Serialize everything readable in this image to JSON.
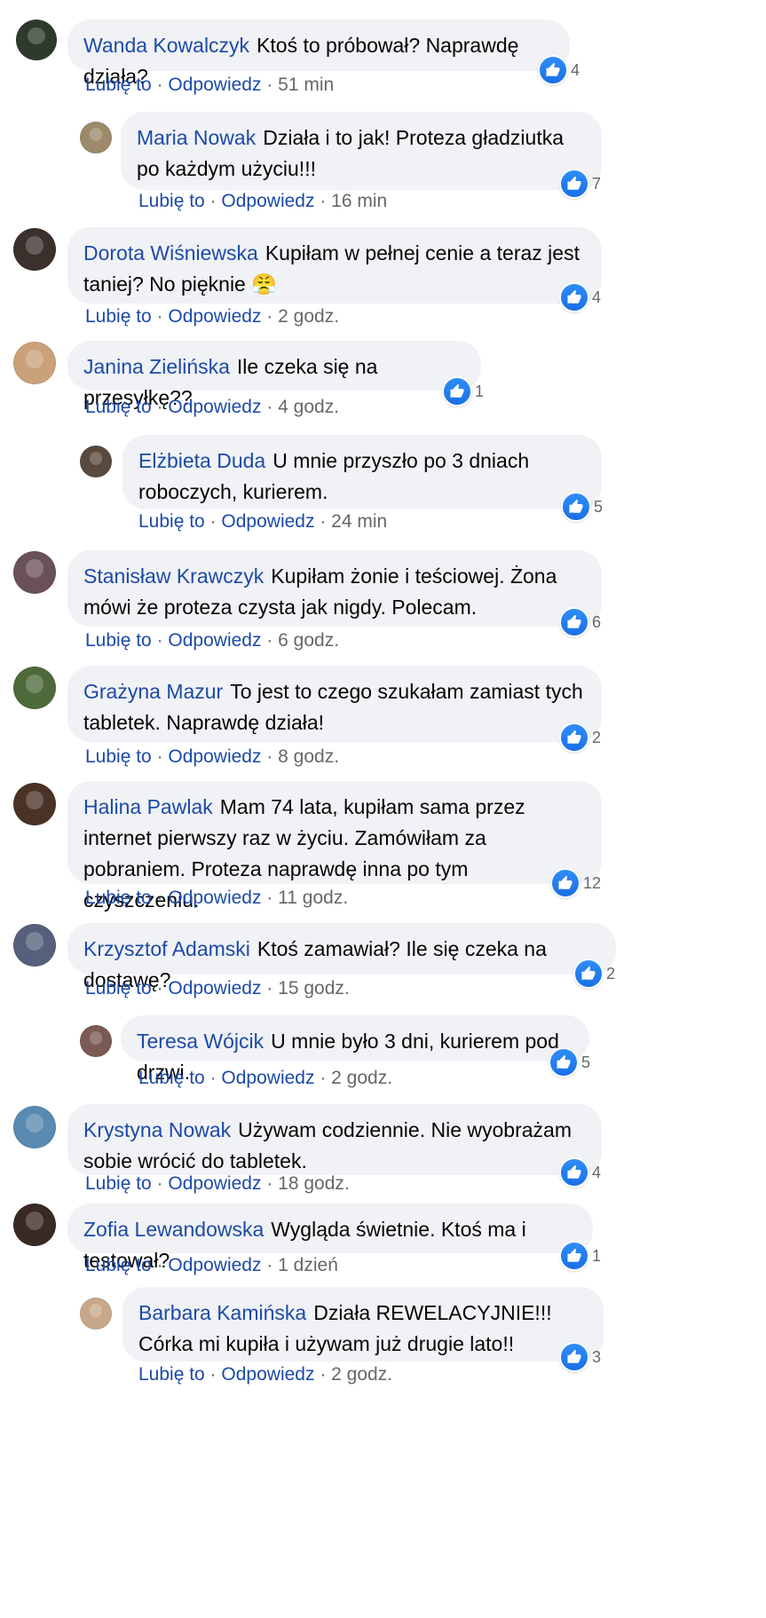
{
  "labels": {
    "like": "Lubię to",
    "reply": "Odpowiedz",
    "separator": "·"
  },
  "colors": {
    "bubble": "#f0f2f5",
    "author": "#1d4aa8",
    "like_badge": "#1877f2",
    "meta": "#65676b"
  },
  "icons": {
    "like": "thumbs-up-icon"
  },
  "comments": [
    {
      "author": "Wanda Kowalczyk",
      "text": "Ktoś to próbował? Naprawdę działa?",
      "likes": "4",
      "time": "51 min",
      "reply": false,
      "avatar_color": "#2e3a2c"
    },
    {
      "author": "Maria Nowak",
      "text": "Działa i to jak! Proteza gładziutka po każdym użyciu!!!",
      "likes": "7",
      "time": "16 min",
      "reply": true,
      "avatar_color": "#9c8a6a"
    },
    {
      "author": "Dorota Wiśniewska",
      "text": "Kupiłam w pełnej cenie a teraz jest taniej? No pięknie 😤",
      "likes": "4",
      "time": "2 godz.",
      "reply": false,
      "avatar_color": "#3b302c"
    },
    {
      "author": "Janina Zielińska",
      "text": "Ile czeka się na przesyłkę??",
      "likes": "1",
      "time": "4 godz.",
      "reply": false,
      "avatar_color": "#c9a27a"
    },
    {
      "author": "Elżbieta Duda",
      "text": "U mnie przyszło po 3 dniach roboczych, kurierem.",
      "likes": "5",
      "time": "24 min",
      "reply": true,
      "avatar_color": "#5a4a3e"
    },
    {
      "author": "Stanisław Krawczyk",
      "text": "Kupiłam żonie i teściowej. Żona mówi że proteza czysta jak nigdy. Polecam.",
      "likes": "6",
      "time": "6 godz.",
      "reply": false,
      "avatar_color": "#6a5058"
    },
    {
      "author": "Grażyna Mazur",
      "text": "To jest to czego szukałam zamiast tych tabletek. Naprawdę działa!",
      "likes": "2",
      "time": "8 godz.",
      "reply": false,
      "avatar_color": "#4e6a3a"
    },
    {
      "author": "Halina Pawlak",
      "text": "Mam 74 lata, kupiłam sama przez internet pierwszy raz w życiu. Zamówiłam za pobraniem. Proteza naprawdę inna po tym czyszczeniu.",
      "likes": "12",
      "time": "11 godz.",
      "reply": false,
      "avatar_color": "#4a3226"
    },
    {
      "author": "Krzysztof Adamski",
      "text": "Ktoś zamawiał? Ile się czeka na dostawę?",
      "likes": "2",
      "time": "15 godz.",
      "reply": false,
      "avatar_color": "#56607a"
    },
    {
      "author": "Teresa Wójcik",
      "text": "U mnie było 3 dni, kurierem pod drzwi.",
      "likes": "5",
      "time": "2 godz.",
      "reply": true,
      "avatar_color": "#7a5a52"
    },
    {
      "author": "Krystyna Nowak",
      "text": "Używam codziennie. Nie wyobrażam sobie wrócić do tabletek.",
      "likes": "4",
      "time": "18 godz.",
      "reply": false,
      "avatar_color": "#5a8ab0"
    },
    {
      "author": "Zofia Lewandowska",
      "text": "Wygląda świetnie. Ktoś ma i testował?",
      "likes": "1",
      "time": "1 dzień",
      "reply": false,
      "avatar_color": "#3a2a24"
    },
    {
      "author": "Barbara Kamińska",
      "text": "Działa REWELACYJNIE!!! Córka mi kupiła i używam już drugie lato!!",
      "likes": "3",
      "time": "2 godz.",
      "reply": true,
      "avatar_color": "#c8a88a"
    }
  ]
}
